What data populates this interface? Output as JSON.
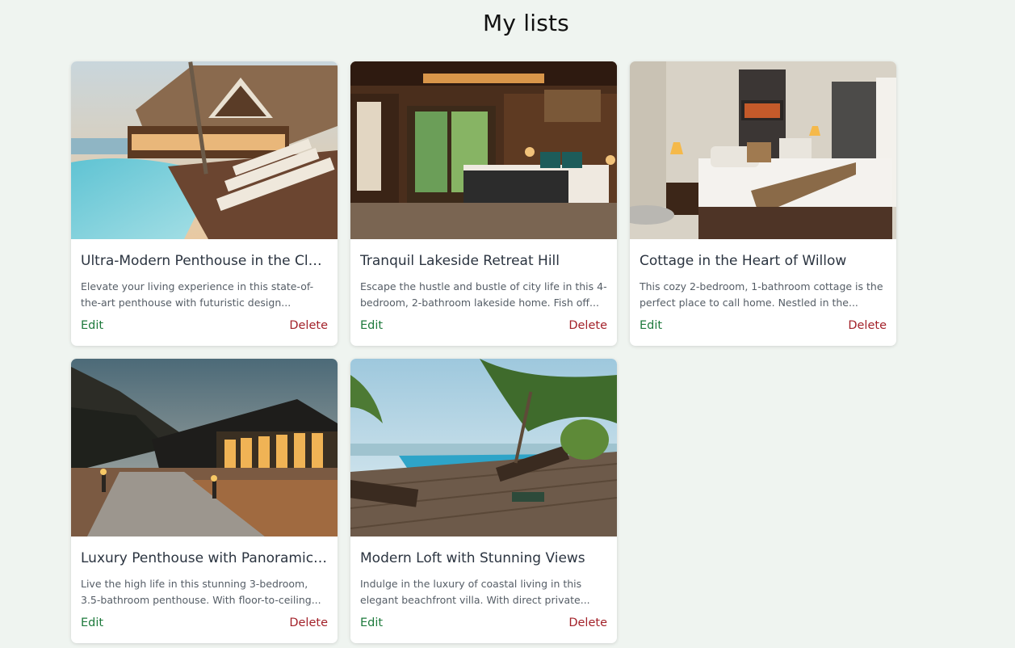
{
  "page": {
    "title": "My lists"
  },
  "actions": {
    "edit_label": "Edit",
    "delete_label": "Delete"
  },
  "listings": [
    {
      "title": "Ultra-Modern Penthouse in the Clo...",
      "description": "Elevate your living experience in this state-of-the-art penthouse with futuristic design..."
    },
    {
      "title": "Tranquil Lakeside Retreat Hill",
      "description": "Escape the hustle and bustle of city life in this 4-bedroom, 2-bathroom lakeside home. Fish off..."
    },
    {
      "title": "Cottage in the Heart of Willow",
      "description": "This cozy 2-bedroom, 1-bathroom cottage is the perfect place to call home. Nestled in the..."
    },
    {
      "title": "Luxury Penthouse with Panoramic ...",
      "description": "Live the high life in this stunning 3-bedroom, 3.5-bathroom penthouse. With floor-to-ceiling..."
    },
    {
      "title": "Modern Loft with Stunning Views",
      "description": "Indulge in the luxury of coastal living in this elegant beachfront villa. With direct private..."
    }
  ]
}
